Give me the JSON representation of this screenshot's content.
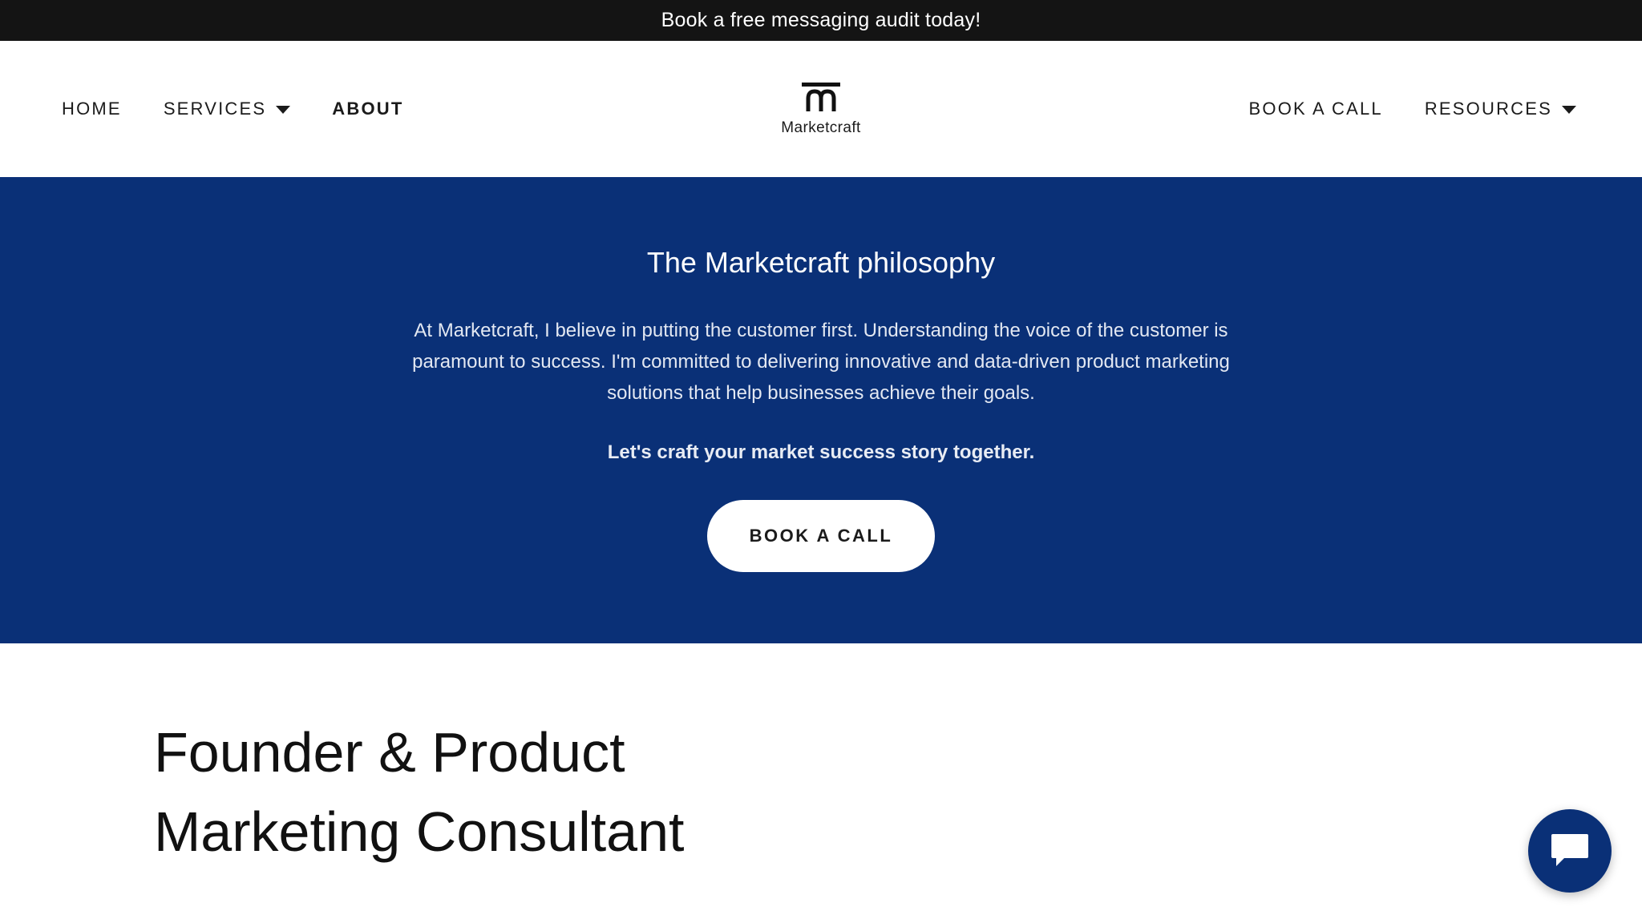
{
  "announcement": {
    "text": "Book a free messaging audit today!"
  },
  "nav": {
    "left": [
      {
        "label": "HOME"
      },
      {
        "label": "SERVICES",
        "dropdown": true
      },
      {
        "label": "ABOUT",
        "active": true
      }
    ],
    "right": [
      {
        "label": "BOOK A CALL"
      },
      {
        "label": "RESOURCES",
        "dropdown": true
      }
    ]
  },
  "logo": {
    "name": "Marketcraft",
    "icon": "marketcraft-logo-icon"
  },
  "hero": {
    "title": "The Marketcraft philosophy",
    "body": "At Marketcraft, I believe in putting the customer first. Understanding the voice of the customer is paramount to success. I'm committed to delivering innovative and data-driven product marketing solutions that help businesses achieve their goals.",
    "tagline": "Let's craft your market success story together.",
    "button_label": "BOOK A CALL"
  },
  "profile": {
    "title": "Founder & Product Marketing Consultant"
  },
  "chat": {
    "icon": "chat-bubble-icon"
  },
  "colors": {
    "announcement_bg": "#141414",
    "hero_bg": "#0a3077",
    "chat_bg": "#0a3077"
  }
}
